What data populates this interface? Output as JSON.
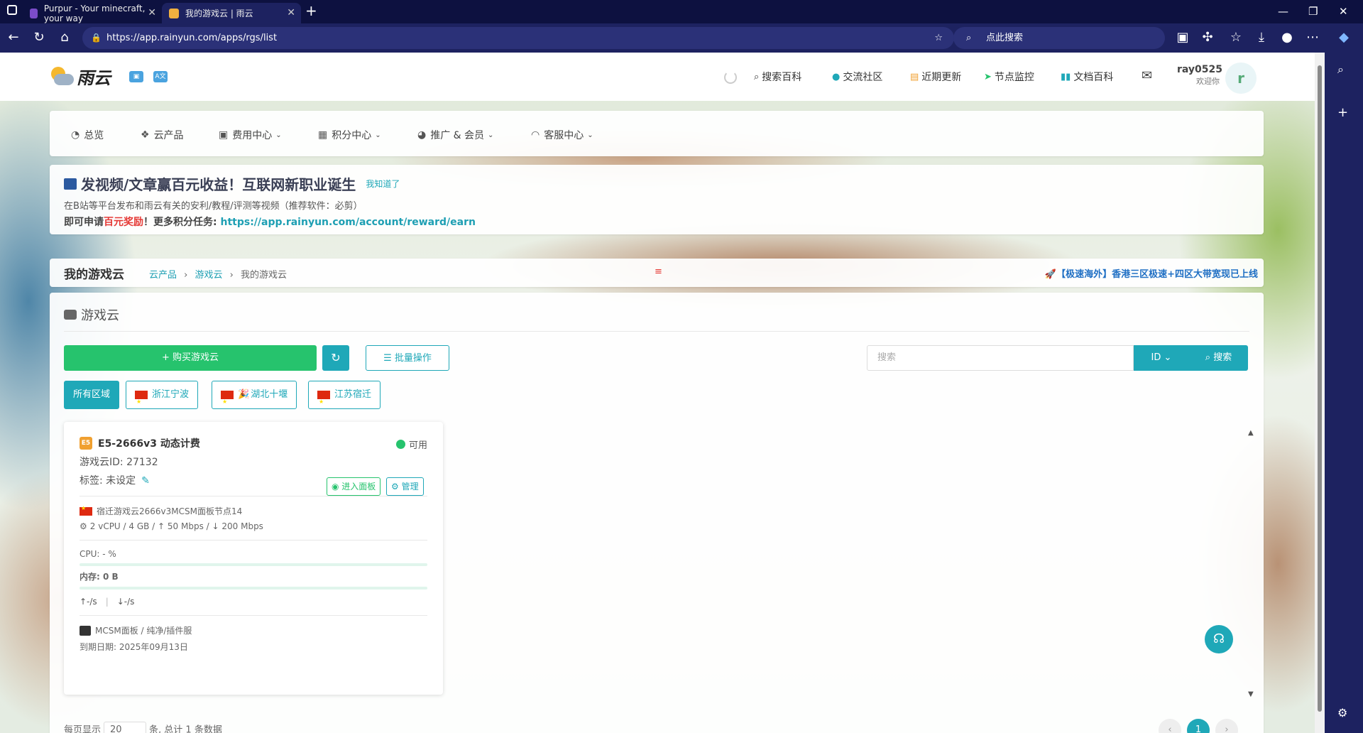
{
  "browser": {
    "tabs": [
      {
        "title": "Purpur - Your minecraft, your way"
      },
      {
        "title": "我的游戏云 | 雨云"
      }
    ],
    "url": "https://app.rainyun.com/apps/rgs/list",
    "search_placeholder": "点此搜索"
  },
  "header": {
    "logo_text": "雨云",
    "nav": [
      {
        "label": "搜索百科",
        "icon": "search-icon"
      },
      {
        "label": "交流社区",
        "icon": "community-icon"
      },
      {
        "label": "近期更新",
        "icon": "update-icon"
      },
      {
        "label": "节点监控",
        "icon": "send-icon"
      },
      {
        "label": "文档百科",
        "icon": "book-icon"
      }
    ],
    "user": {
      "name": "ray0525",
      "greeting": "欢迎你",
      "avatar_letter": "r"
    }
  },
  "menu": [
    {
      "label": "总览",
      "dropdown": false
    },
    {
      "label": "云产品",
      "dropdown": false
    },
    {
      "label": "费用中心",
      "dropdown": true
    },
    {
      "label": "积分中心",
      "dropdown": true
    },
    {
      "label": "推广 & 会员",
      "dropdown": true
    },
    {
      "label": "客服中心",
      "dropdown": true
    }
  ],
  "notice": {
    "title": "发视频/文章赢百元收益！互联网新职业诞生",
    "dismiss": "我知道了",
    "line1": "在B站等平台发布和雨云有关的安利/教程/评测等视频（推荐软件：必剪）",
    "line2_prefix": "即可申请",
    "line2_red": "百元奖励",
    "line2_mid": "！更多积分任务: ",
    "line2_link": "https://app.rainyun.com/account/reward/earn"
  },
  "breadcrumb": {
    "title": "我的游戏云",
    "items": [
      "云产品",
      "游戏云",
      "我的游戏云"
    ],
    "promo": "【极速海外】香港三区极速+四区大带宽现已上线"
  },
  "main": {
    "title": "游戏云",
    "buy_label": "+ 购买游戏云",
    "batch_label": "批量操作",
    "search_placeholder": "搜索",
    "id_select": "ID",
    "search_button": "搜索",
    "regions": [
      "所有区域",
      "浙江宁波",
      "湖北十堰",
      "江苏宿迁"
    ]
  },
  "server": {
    "cpu_name": "E5-2666v3 动态计费",
    "badge": "E5",
    "status": "可用",
    "id_line": "游戏云ID: 27132",
    "tag_line": "标签: 未设定",
    "enter_label": "进入面板",
    "manage_label": "管理",
    "node": "宿迁游戏云2666v3MCSM面板节点14",
    "spec": "2 vCPU / 4 GB / ↑ 50 Mbps / ↓ 200 Mbps",
    "cpu_usage": "CPU: - %",
    "mem_usage": "内存: 0 B",
    "up": "↑-/s",
    "down": "↓-/s",
    "panel": "MCSM面板 / 纯净/插件服",
    "expire": "到期日期: 2025年09月13日"
  },
  "footer": {
    "per_page_prefix": "每页显示",
    "per_page_value": "20",
    "per_page_suffix": "条, 总计 1 条数据",
    "current_page": "1"
  }
}
